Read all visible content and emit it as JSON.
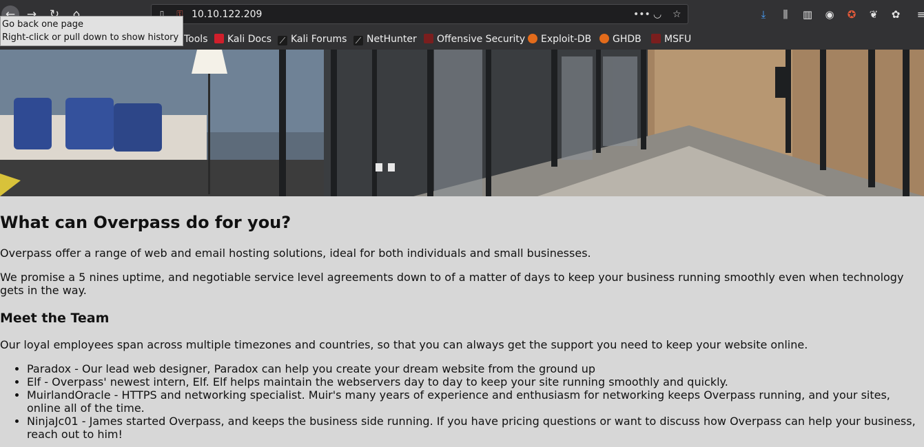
{
  "browser": {
    "url": "10.10.122.209",
    "tooltip": {
      "line1": "Go back one page",
      "line2": "Right-click or pull down to show history"
    },
    "bookmarks": [
      {
        "label": "Tools",
        "icon": "kali-tools-icon",
        "color": "#e63946"
      },
      {
        "label": "Kali Docs",
        "icon": "kali-docs-icon",
        "color": "#d01f2b"
      },
      {
        "label": "Kali Forums",
        "icon": "kali-dragon-icon",
        "color": "#1b1b1b"
      },
      {
        "label": "NetHunter",
        "icon": "nethunter-dragon-icon",
        "color": "#1b1b1b"
      },
      {
        "label": "Offensive Security",
        "icon": "offsec-icon",
        "color": "#7a1e1e"
      },
      {
        "label": "Exploit-DB",
        "icon": "exploitdb-icon",
        "color": "#e36b1b"
      },
      {
        "label": "GHDB",
        "icon": "ghdb-icon",
        "color": "#e36b1b"
      },
      {
        "label": "MSFU",
        "icon": "msfu-icon",
        "color": "#7a1e1e"
      }
    ]
  },
  "page": {
    "heading": "What can Overpass do for you?",
    "intro": "Overpass offer a range of web and email hosting solutions, ideal for both individuals and small businesses.",
    "promise": "We promise a 5 nines uptime, and negotiable service level agreements down to of a matter of days to keep your business running smoothly even when technology gets in the way.",
    "team_heading": "Meet the Team",
    "team_intro": "Our loyal employees span across multiple timezones and countries, so that you can always get the support you need to keep your website online.",
    "team": [
      "Paradox - Our lead web designer, Paradox can help you create your dream website from the ground up",
      "Elf - Overpass' newest intern, Elf. Elf helps maintain the webservers day to day to keep your site running smoothly and quickly.",
      "MuirlandOracle - HTTPS and networking specialist. Muir's many years of experience and enthusiasm for networking keeps Overpass running, and your sites, online all of the time.",
      "NinjaJc01 - James started Overpass, and keeps the business side running. If you have pricing questions or want to discuss how Overpass can help your business, reach out to him!"
    ]
  }
}
